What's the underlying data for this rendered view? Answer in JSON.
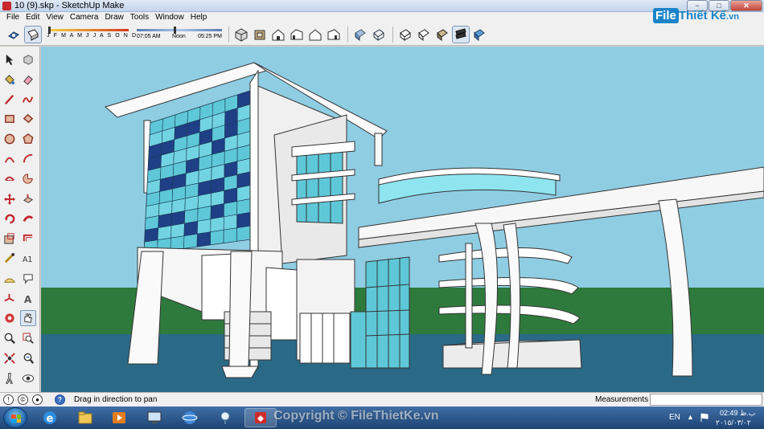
{
  "window": {
    "title": "10 (9).skp - SketchUp Make",
    "min_label": "−",
    "max_label": "□",
    "close_label": "✕"
  },
  "menu": [
    "File",
    "Edit",
    "View",
    "Camera",
    "Draw",
    "Tools",
    "Window",
    "Help"
  ],
  "logo": {
    "box": "File",
    "name": "Thiết Kế",
    "domain": ".vn"
  },
  "shadow_settings": {
    "months": "J F M A M J J A S O N D",
    "time_start": "07:05 AM",
    "time_mid": "Noon",
    "time_end": "05:25 PM"
  },
  "toolbar_icons": [
    "orbit-icon",
    "select-face-icon",
    "iso-view-icon",
    "top-view-icon",
    "front-view-icon",
    "right-view-icon",
    "back-view-icon",
    "left-view-icon",
    "xray-icon",
    "wireframe-icon",
    "hidden-line-icon",
    "shaded-icon",
    "shaded-textures-icon",
    "monochrome-icon"
  ],
  "left_tools": [
    "select-icon",
    "component-icon",
    "paint-bucket-icon",
    "eraser-icon",
    "pencil-line-icon",
    "freehand-icon",
    "rectangle-icon",
    "rotated-rect-icon",
    "circle-icon",
    "polygon-icon",
    "arc-icon",
    "arc-2pt-icon",
    "arc-3pt-icon",
    "pie-icon",
    "move-icon",
    "push-pull-icon",
    "rotate-icon",
    "follow-me-icon",
    "scale-icon",
    "offset-icon",
    "tape-measure-icon",
    "dimension-icon",
    "protractor-icon",
    "text-icon",
    "axes-icon",
    "3d-text-icon",
    "orbit-tool-icon",
    "pan-tool-icon",
    "zoom-icon",
    "zoom-window-icon",
    "zoom-extents-icon",
    "previous-view-icon",
    "walk-icon",
    "look-around-icon"
  ],
  "status": {
    "hint": "Drag in direction to pan",
    "measurements_label": "Measurements",
    "measurements_value": ""
  },
  "taskbar": {
    "copyright": "Copyright © FileThietKe.vn",
    "lang": "EN",
    "tray_arrow": "▲",
    "time": "02:49 ب.ظ",
    "date": "٢٠١٥/٠٣/٠٢"
  },
  "colors": {
    "sky": "#8fcde3",
    "ground": "#2e7a3c",
    "water": "#2a6a87",
    "glass_light": "#5ec8d8",
    "glass_dark": "#1f3f86",
    "wall": "#f5f5f5"
  }
}
